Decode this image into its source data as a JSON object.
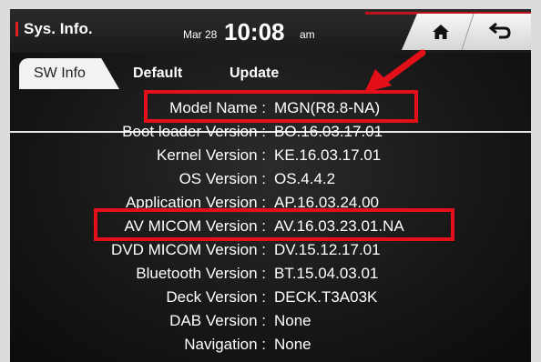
{
  "header": {
    "title": "Sys. Info.",
    "date": "Mar 28",
    "time": "10:08",
    "ampm": "am"
  },
  "nav": {
    "home_icon": "home-icon",
    "back_icon": "back-arrow-icon"
  },
  "tabs": [
    {
      "label": "SW Info",
      "active": true
    },
    {
      "label": "Default",
      "active": false
    },
    {
      "label": "Update",
      "active": false
    }
  ],
  "info_rows": [
    {
      "label": "Model Name :",
      "value": "MGN(R8.8-NA)"
    },
    {
      "label": "Boot loader Version :",
      "value": "BO.16.03.17.01"
    },
    {
      "label": "Kernel Version :",
      "value": "KE.16.03.17.01"
    },
    {
      "label": "OS Version :",
      "value": "OS.4.4.2"
    },
    {
      "label": "Application Version :",
      "value": "AP.16.03.24.00"
    },
    {
      "label": "AV MICOM Version :",
      "value": "AV.16.03.23.01.NA"
    },
    {
      "label": "DVD MICOM Version :",
      "value": "DV.15.12.17.01"
    },
    {
      "label": "Bluetooth Version :",
      "value": "BT.15.04.03.01"
    },
    {
      "label": "Deck Version :",
      "value": "DECK.T3A03K"
    },
    {
      "label": "DAB Version :",
      "value": "None"
    },
    {
      "label": "Navigation :",
      "value": "None"
    }
  ],
  "annotation_colors": {
    "highlight": "#e3101a",
    "accent": "#c0121a"
  }
}
